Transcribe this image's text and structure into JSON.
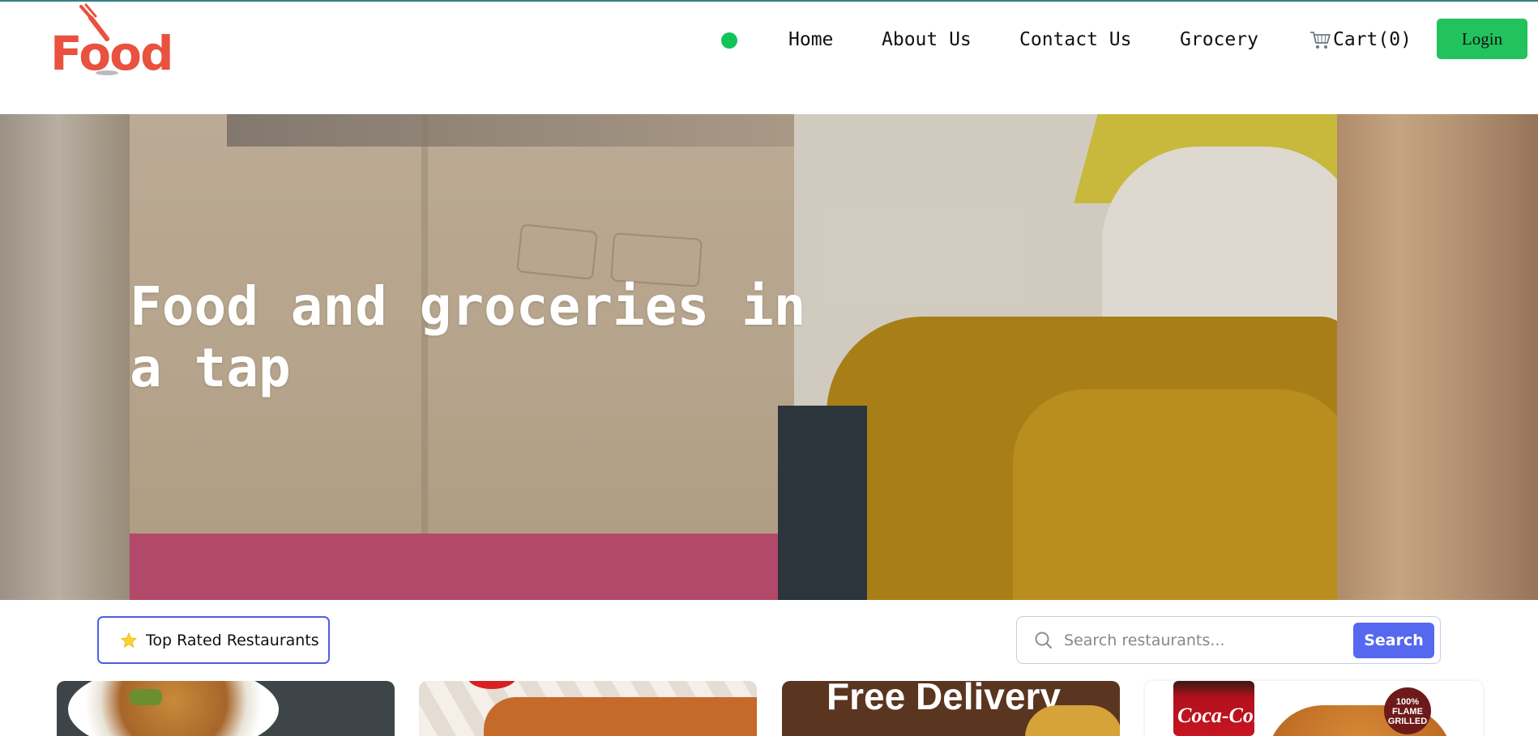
{
  "header": {
    "logo_text": "Food",
    "nav": {
      "home": "Home",
      "about": "About Us",
      "contact": "Contact Us",
      "grocery": "Grocery"
    },
    "cart_label": "Cart(0)",
    "cart_icon": "cart-icon",
    "login_label": "Login",
    "status_color": "#12c35a",
    "login_color": "#22c25c",
    "brand_color": "#e8523f"
  },
  "hero": {
    "title": "Food and groceries in a tap"
  },
  "filters": {
    "top_rated_label": "Top Rated Restaurants",
    "top_rated_icon": "star-icon",
    "search_placeholder": "Search restaurants...",
    "search_button": "Search",
    "accent_color": "#5568ef"
  },
  "cards": {
    "card3_text": "Free Delivery",
    "card4_brand": "Coca-Cola",
    "card4_badge": "100% FLAME GRILLED"
  }
}
